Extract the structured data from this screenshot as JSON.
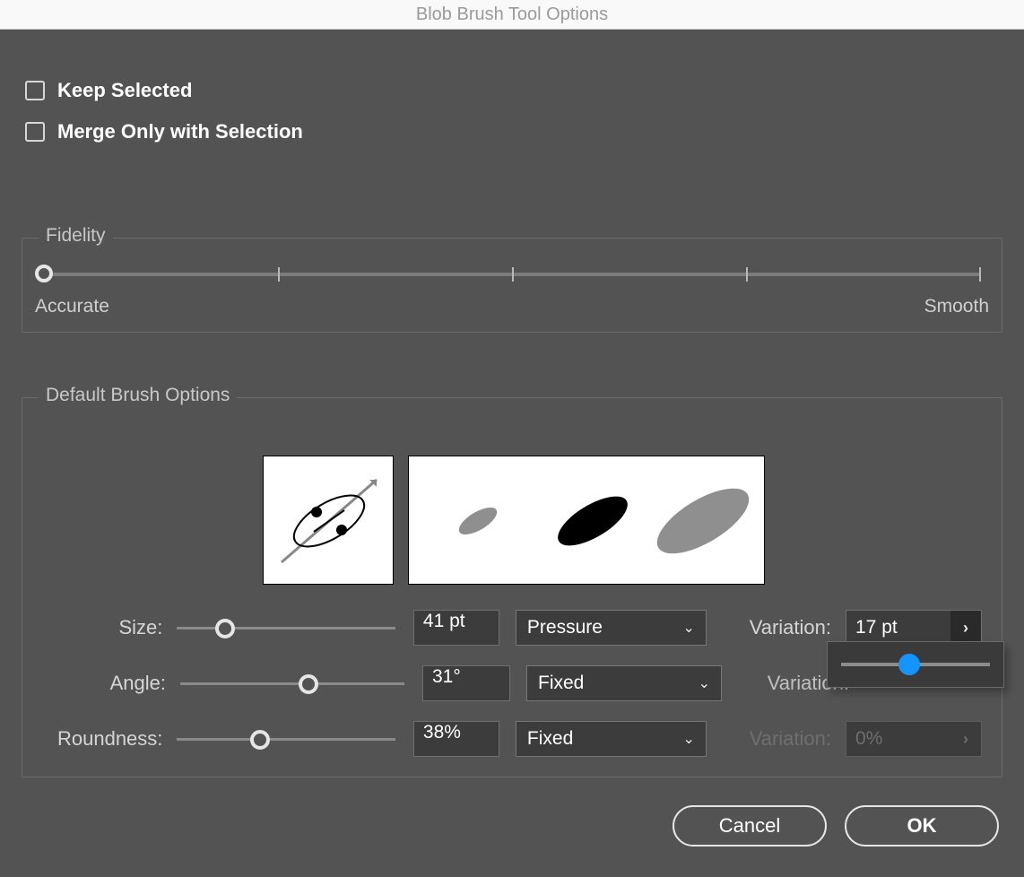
{
  "window": {
    "title": "Blob Brush Tool Options"
  },
  "checkboxes": {
    "keep_selected": {
      "label": "Keep Selected",
      "checked": false
    },
    "merge_only_sel": {
      "label": "Merge Only with Selection",
      "checked": false
    }
  },
  "fidelity": {
    "legend": "Fidelity",
    "left_label": "Accurate",
    "right_label": "Smooth",
    "value_pct": 0
  },
  "brush_opts": {
    "legend": "Default Brush Options",
    "size": {
      "label": "Size:",
      "value": "41 pt",
      "slider_pct": 22,
      "control_select": "Pressure",
      "variation": {
        "label": "Variation:",
        "value": "17 pt",
        "enabled": true
      }
    },
    "angle": {
      "label": "Angle:",
      "value": "31°",
      "slider_pct": 57,
      "control_select": "Fixed",
      "variation": {
        "label": "Variation:",
        "value": "",
        "enabled_hint": "partial"
      }
    },
    "roundness": {
      "label": "Roundness:",
      "value": "38%",
      "slider_pct": 38,
      "control_select": "Fixed",
      "variation": {
        "label": "Variation:",
        "value": "0%",
        "enabled": false
      }
    }
  },
  "variation_popup": {
    "value_pct": 46
  },
  "footer": {
    "cancel": "Cancel",
    "ok": "OK"
  }
}
